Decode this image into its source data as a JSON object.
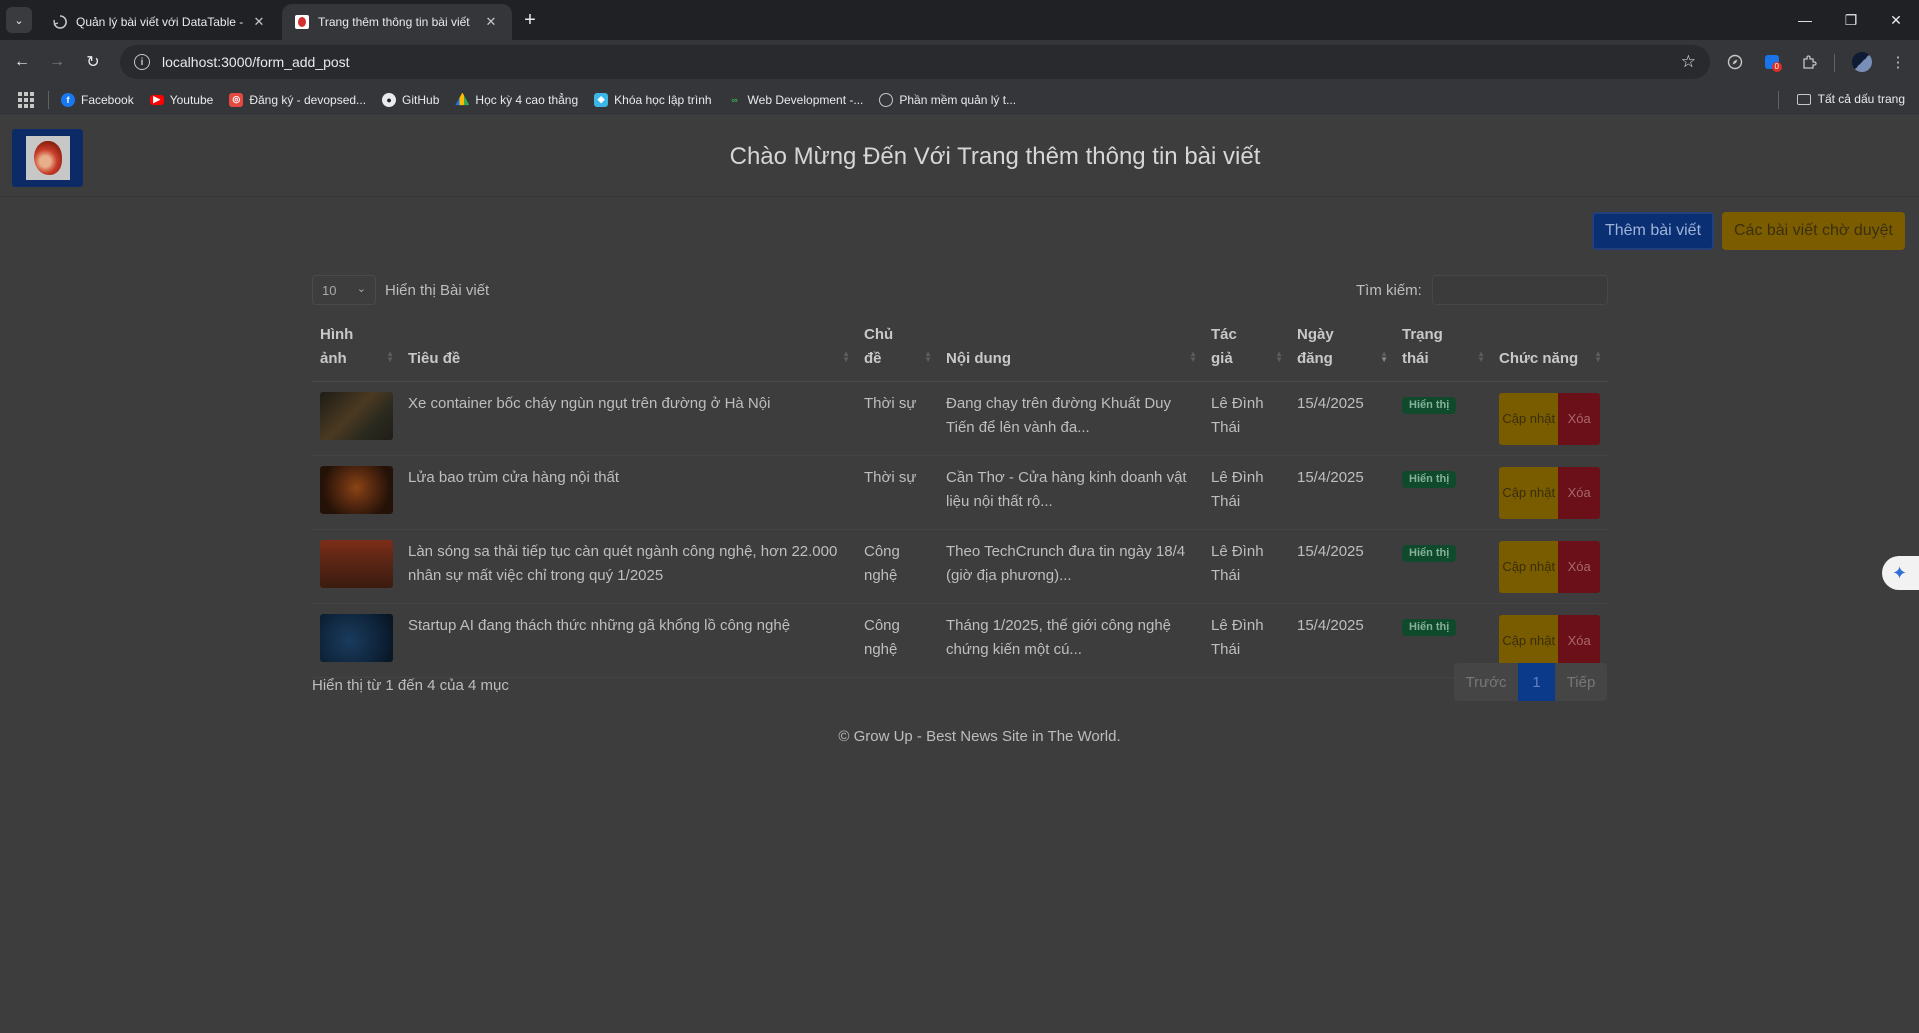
{
  "browser": {
    "tabs": [
      {
        "title": "Quản lý bài viết với DataTable -",
        "active": false
      },
      {
        "title": "Trang thêm thông tin bài viết",
        "active": true
      }
    ],
    "url": "localhost:3000/form_add_post",
    "extension_badge": "0",
    "bookmarks": [
      {
        "label": "Facebook",
        "icon": "facebook-icon",
        "color": "#1877f2"
      },
      {
        "label": "Youtube",
        "icon": "youtube-icon",
        "color": "#ff0000"
      },
      {
        "label": "Đăng ký - devopsed...",
        "icon": "devopsedu-icon",
        "color": "#e5483e"
      },
      {
        "label": "GitHub",
        "icon": "github-icon",
        "color": "#ffffff"
      },
      {
        "label": "Học kỳ 4 cao thẳng",
        "icon": "drive-icon",
        "color": "#fbbc04"
      },
      {
        "label": "Khóa học lập trình",
        "icon": "course-icon",
        "color": "#3ab7e6"
      },
      {
        "label": "Web Development -...",
        "icon": "webdev-icon",
        "color": "#1e8e3e"
      },
      {
        "label": "Phần mềm quản lý t...",
        "icon": "globe-icon",
        "color": "#c4c7c5"
      }
    ],
    "all_bookmarks_label": "Tất cả dấu trang"
  },
  "page": {
    "title": "Chào Mừng Đến Với Trang thêm thông tin bài viết",
    "add_button": "Thêm bài viết",
    "pending_button": "Các bài viết chờ duyệt"
  },
  "datatable": {
    "page_length": "10",
    "length_label": "Hiển thị Bài viết",
    "search_label": "Tìm kiếm:",
    "search_value": "",
    "columns": [
      "Hình ảnh",
      "Tiêu đề",
      "Chủ đề",
      "Nội dung",
      "Tác giả",
      "Ngày đăng",
      "Trạng thái",
      "Chức năng"
    ],
    "sorted_column": "Ngày đăng",
    "rows": [
      {
        "title": "Xe container bốc cháy ngùn ngụt trên đường ở Hà Nội",
        "topic": "Thời sự",
        "content": "Đang chạy trên đường Khuất Duy Tiến để lên vành đa...",
        "author": "Lê Đình Thái",
        "date": "15/4/2025",
        "status": "Hiển thị",
        "update": "Cập nhật",
        "delete": "Xóa"
      },
      {
        "title": "Lửa bao trùm cửa hàng nội thất",
        "topic": "Thời sự",
        "content": "Cần Thơ - Cửa hàng kinh doanh vật liệu nội thất rộ...",
        "author": "Lê Đình Thái",
        "date": "15/4/2025",
        "status": "Hiển thị",
        "update": "Cập nhật",
        "delete": "Xóa"
      },
      {
        "title": "Làn sóng sa thải tiếp tục càn quét ngành công nghệ, hơn 22.000 nhân sự mất việc chỉ trong quý 1/2025",
        "topic": "Công nghệ",
        "content": "Theo TechCrunch đưa tin ngày 18/4 (giờ địa phương)...",
        "author": "Lê Đình Thái",
        "date": "15/4/2025",
        "status": "Hiển thị",
        "update": "Cập nhật",
        "delete": "Xóa"
      },
      {
        "title": "Startup AI đang thách thức những gã khổng lồ công nghệ",
        "topic": "Công nghệ",
        "content": "Tháng 1/2025, thế giới công nghệ chứng kiến một cú...",
        "author": "Lê Đình Thái",
        "date": "15/4/2025",
        "status": "Hiển thị",
        "update": "Cập nhật",
        "delete": "Xóa"
      }
    ],
    "info": "Hiển thị từ 1 đến 4 của 4 mục",
    "pagination": {
      "prev": "Trước",
      "current": "1",
      "next": "Tiếp"
    }
  },
  "footer": {
    "text": "© Grow Up - Best News Site in The World."
  },
  "colors": {
    "primary": "#0b2f73",
    "warning": "#7b5d00",
    "danger": "#6b1018",
    "success_badge": "#0f4a2d"
  }
}
